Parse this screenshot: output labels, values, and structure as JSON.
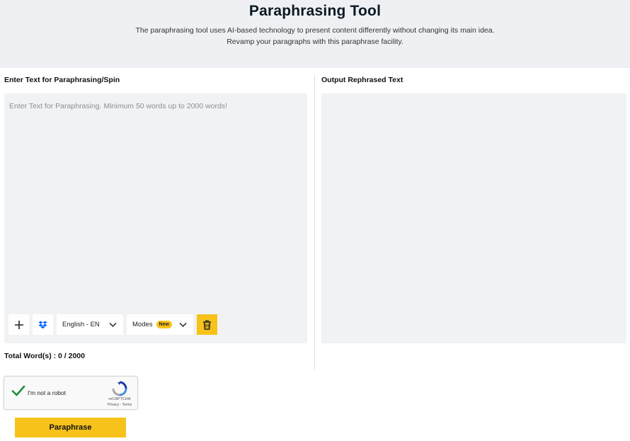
{
  "header": {
    "title": "Paraphrasing Tool",
    "description": "The paraphrasing tool uses AI-based technology to present content differently without changing its main idea. Revamp your paragraphs with this paraphrase facility."
  },
  "input_panel": {
    "label": "Enter Text for Paraphrasing/Spin",
    "placeholder": "Enter Text for Paraphrasing. Minimum 50 words up to 2000 words!",
    "value": ""
  },
  "toolbar": {
    "add_icon": "plus-icon",
    "dropbox_icon": "dropbox-icon",
    "language": "English - EN",
    "modes_label": "Modes",
    "modes_badge": "New",
    "delete_icon": "trash-icon"
  },
  "output_panel": {
    "label": "Output Rephrased Text",
    "value": ""
  },
  "word_count": {
    "text": "Total Word(s) : 0 / 2000"
  },
  "captcha": {
    "label": "I'm not a robot",
    "brand": "reCAPTCHA",
    "links": "Privacy - Terms",
    "checked": true
  },
  "actions": {
    "paraphrase_label": "Paraphrase"
  },
  "colors": {
    "accent": "#f7c21a",
    "hero_bg": "#eef0f3",
    "panel_bg": "#f1f2f4",
    "check_green": "#1e8e3e",
    "dropbox_blue": "#0061fe"
  }
}
